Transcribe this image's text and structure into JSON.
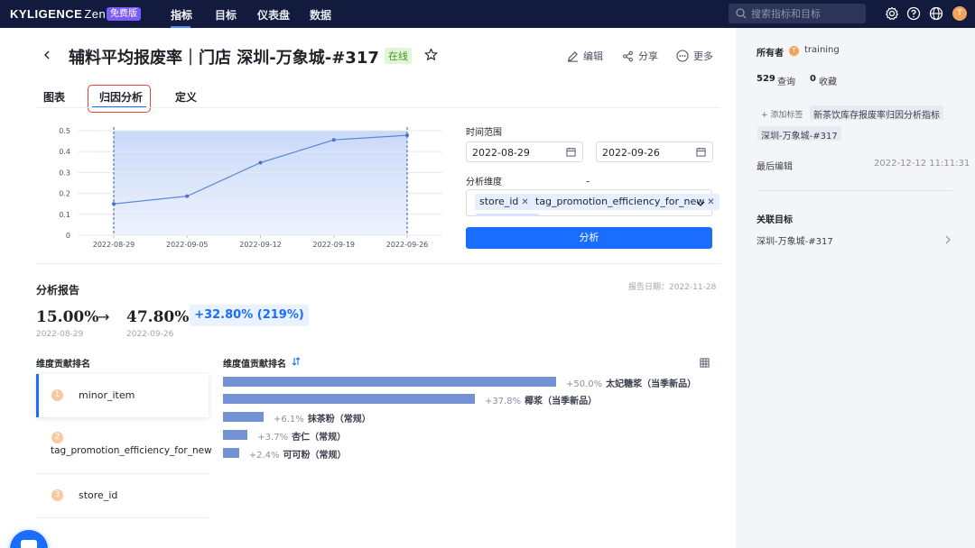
{
  "nav": {
    "logo": "KYLIGENCE",
    "logo_suffix": "Zen",
    "free_badge": "免费版",
    "items": [
      {
        "label": "指标"
      },
      {
        "label": "目标"
      },
      {
        "label": "仪表盘"
      },
      {
        "label": "数据"
      }
    ],
    "active_item": "指标",
    "search_placeholder": "搜索指标和目标",
    "avatar_initial": "T"
  },
  "header": {
    "title": "辅料平均报废率｜门店 深圳-万象城-#317",
    "status_badge": "在线",
    "actions": [
      {
        "label": "编辑",
        "icon": "edit-icon"
      },
      {
        "label": "分享",
        "icon": "share-icon"
      },
      {
        "label": "更多",
        "icon": "more-icon"
      }
    ]
  },
  "tabs": [
    {
      "label": "图表"
    },
    {
      "label": "归因分析"
    },
    {
      "label": "定义"
    }
  ],
  "active_tab": "归因分析",
  "chart_data": {
    "type": "area",
    "x": [
      "2022-08-29",
      "2022-09-05",
      "2022-09-12",
      "2022-09-19",
      "2022-09-26"
    ],
    "y": [
      0.15,
      0.187,
      0.347,
      0.456,
      0.478
    ],
    "yticks": [
      "0",
      "0.1",
      "0.2",
      "0.3",
      "0.4",
      "0.5"
    ],
    "ylim": [
      0,
      0.5
    ],
    "grid": true,
    "selection_range": [
      "2022-08-29",
      "2022-09-26"
    ]
  },
  "filters": {
    "time_label": "时间范围",
    "start_date": "2022-08-29",
    "end_date": "2022-09-26",
    "separator": "-",
    "dim_label": "分析维度",
    "dimensions": [
      {
        "label": "store_id"
      },
      {
        "label": "tag_promotion_efficiency_for_new"
      }
    ],
    "analyze_button": "分析"
  },
  "report": {
    "title": "分析报告",
    "date": "报告日期：2022-11-28",
    "start_value": "15.00%",
    "end_value": "47.80%",
    "arrow": "→",
    "change": "+32.80% (219%)",
    "start_date": "2022-08-29",
    "end_date": "2022-09-26",
    "dim_rank_title": "维度贡献排名",
    "value_rank_title": "维度值贡献排名",
    "dimension_rank": [
      {
        "rank": "1",
        "label": "minor_item"
      },
      {
        "rank": "2",
        "label": "tag_promotion_efficiency_for_new"
      },
      {
        "rank": "3",
        "label": "store_id"
      }
    ],
    "value_rank": [
      {
        "pct": "+50.0%",
        "name": "太妃糖浆（当季新品）",
        "value": 50.0
      },
      {
        "pct": "+37.8%",
        "name": "椰浆（当季新品）",
        "value": 37.8
      },
      {
        "pct": "+6.1%",
        "name": "抹茶粉（常规）",
        "value": 6.1
      },
      {
        "pct": "+3.7%",
        "name": "杏仁（常规）",
        "value": 3.7
      },
      {
        "pct": "+2.4%",
        "name": "可可粉（常规）",
        "value": 2.4
      }
    ]
  },
  "sidebar": {
    "owner_label": "所有者",
    "owner_initial": "T",
    "owner_name": "training",
    "query_count": "529",
    "query_label": "查询",
    "fav_count": "0",
    "fav_label": "收藏",
    "add_tag": "添加标签",
    "tags": [
      "新茶饮库存报废率归因分析指标",
      "深圳-万象城-#317"
    ],
    "last_edit_label": "最后编辑",
    "last_edit_time": "2022-12-12 11:11:31",
    "linked_goal_title": "关联目标",
    "linked_goal": "深圳-万象城-#317"
  }
}
